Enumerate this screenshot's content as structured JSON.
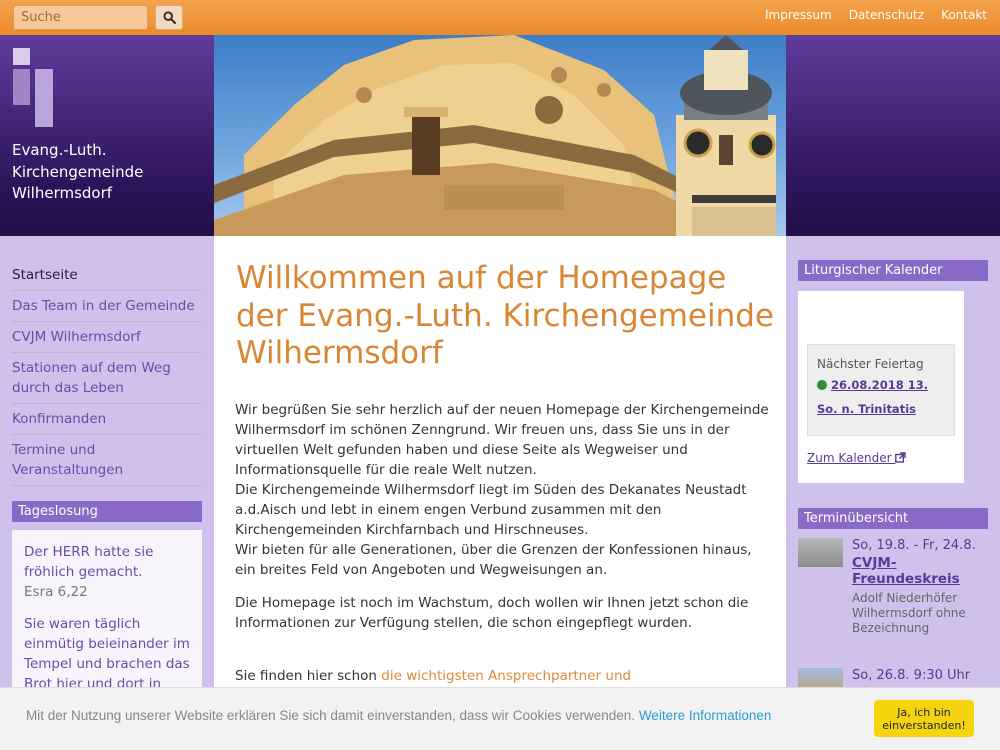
{
  "topbar": {
    "search_placeholder": "Suche",
    "search_icon": "search-icon",
    "links": [
      "Impressum",
      "Datenschutz",
      "Kontakt"
    ]
  },
  "header": {
    "brand_lines": [
      "Evang.-Luth.",
      "Kirchengemeinde",
      "Wilhermsdorf"
    ]
  },
  "nav": {
    "items": [
      "Startseite",
      "Das Team in der Gemeinde",
      "CVJM Wilhermsdorf",
      "Stationen auf dem Weg durch das Leben",
      "Konfirmanden",
      "Termine und Veranstaltungen"
    ]
  },
  "tageslosung": {
    "title": "Tageslosung",
    "verse1": "Der HERR hatte sie fröhlich gemacht.",
    "ref1": "Esra 6,22",
    "verse2": "Sie waren täglich einmütig beieinander im Tempel und brachen das Brot hier und dort in"
  },
  "main": {
    "title": "Willkommen auf der Homepage der Evang.-Luth. Kirchengemeinde Wilhermsdorf",
    "p1": "Wir begrüßen Sie sehr herzlich auf der neuen Homepage der Kirchengemeinde Wilhermsdorf im schönen Zenngrund. Wir freuen uns, dass Sie uns in der virtuellen Welt gefunden haben und diese Seite als Wegweiser und Informationsquelle für die reale Welt nutzen.",
    "p2": "Die Kirchengemeinde Wilhermsdorf liegt im Süden des Dekanates Neustadt a.d.Aisch und lebt in einem engen Verbund zusammen mit den Kirchengemeinden Kirchfarnbach und Hirschneuses.",
    "p3": "Wir bieten für alle Generationen, über die Grenzen der Konfessionen hinaus, ein breites Feld von Angeboten und Wegweisungen an.",
    "p4": "Die Homepage ist noch im Wachstum, doch wollen wir Ihnen jetzt schon die Informationen zur Verfügung stellen, die schon eingepflegt wurden.",
    "p5_prefix": "Sie finden hier schon ",
    "p5_link": "die wichtigsten Ansprechpartner und"
  },
  "kalender": {
    "title": "Liturgischer Kalender",
    "next_label": "Nächster Feiertag",
    "next_value": "26.08.2018 13. So. n. Trinitatis",
    "status_color": "#2f8a3a",
    "link": "Zum Kalender",
    "link_icon": "external-link-icon"
  },
  "termine": {
    "title": "Terminübersicht",
    "events": [
      {
        "date": "So, 19.8. - Fr, 24.8.",
        "title": "CVJM-Freundeskreis",
        "desc": "Adolf Niederhöfer Wilhermsdorf ohne Bezeichnung"
      },
      {
        "date": "So, 26.8. 9:30 Uhr",
        "title": "",
        "desc": ""
      }
    ]
  },
  "cookie": {
    "text": "Mit der Nutzung unserer Website erklären Sie sich damit einverstanden, dass wir Cookies verwenden.",
    "more_link": "Weitere Informationen",
    "accept_line1": "Ja, ich bin",
    "accept_line2": "einverstanden!"
  },
  "colors": {
    "accent_orange": "#ea8a2c",
    "header_purple": "#2c145a",
    "sidebar_lilac": "#cfc0ec",
    "cookie_button": "#f4d40e"
  }
}
